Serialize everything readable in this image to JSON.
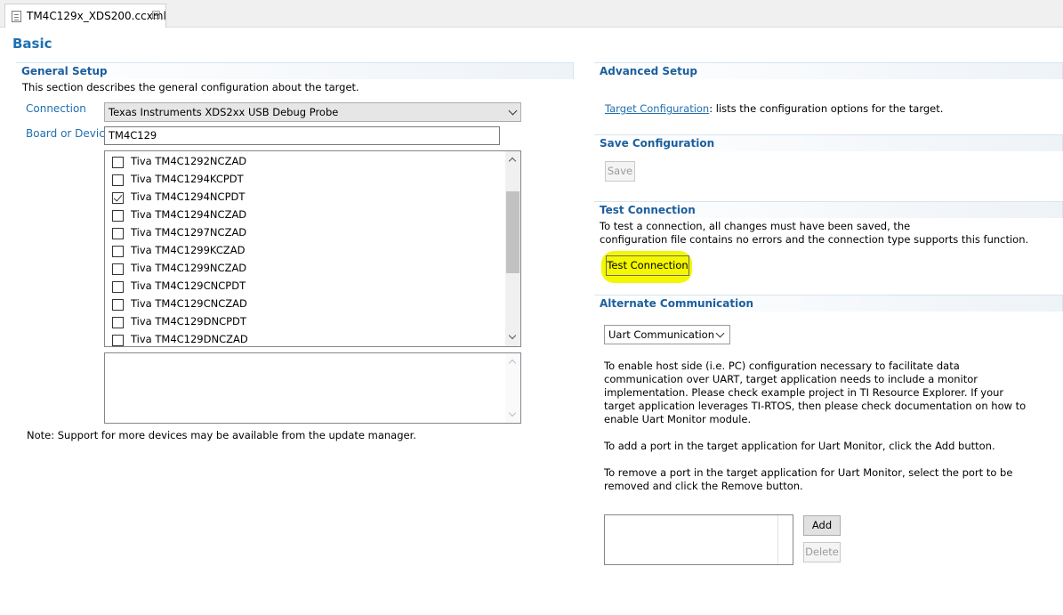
{
  "tab": {
    "title": "TM4C129x_XDS200.ccxml",
    "close_glyph": "☒"
  },
  "page": {
    "title": "Basic"
  },
  "general_setup": {
    "header": "General Setup",
    "description": "This section describes the general configuration about the target.",
    "connection_label": "Connection",
    "connection_value": "Texas Instruments XDS2xx USB Debug Probe",
    "board_label": "Board or Device",
    "board_value": "TM4C129",
    "devices": [
      {
        "label": "Tiva TM4C1292NCZAD",
        "checked": false
      },
      {
        "label": "Tiva TM4C1294KCPDT",
        "checked": false
      },
      {
        "label": "Tiva TM4C1294NCPDT",
        "checked": true
      },
      {
        "label": "Tiva TM4C1294NCZAD",
        "checked": false
      },
      {
        "label": "Tiva TM4C1297NCZAD",
        "checked": false
      },
      {
        "label": "Tiva TM4C1299KCZAD",
        "checked": false
      },
      {
        "label": "Tiva TM4C1299NCZAD",
        "checked": false
      },
      {
        "label": "Tiva TM4C129CNCPDT",
        "checked": false
      },
      {
        "label": "Tiva TM4C129CNCZAD",
        "checked": false
      },
      {
        "label": "Tiva TM4C129DNCPDT",
        "checked": false
      },
      {
        "label": "Tiva TM4C129DNCZAD",
        "checked": false
      }
    ],
    "note": "Note: Support for more devices may be available from the update manager."
  },
  "advanced_setup": {
    "header": "Advanced Setup",
    "link_text": "Target Configuration",
    "link_suffix": ": lists the configuration options for the target."
  },
  "save_configuration": {
    "header": "Save Configuration",
    "save_button": "Save"
  },
  "test_connection": {
    "header": "Test Connection",
    "line1": "To test a connection, all changes must have been saved, the",
    "line2": "configuration file contains no errors and the connection type supports this function.",
    "button": "Test Connection",
    "highlight_color": "#f4f700"
  },
  "alternate_communication": {
    "header": "Alternate Communication",
    "select_value": "Uart Communication",
    "para1": [
      "To enable host side (i.e. PC) configuration necessary to facilitate data",
      "communication over UART, target application needs to include a monitor",
      "implementation. Please check example project in TI Resource Explorer. If your",
      "target application leverages TI-RTOS, then please check documentation on how to",
      "enable Uart Monitor module."
    ],
    "para2": "To add a port in the target application for Uart Monitor, click the Add button.",
    "para3": [
      "To remove a port in the target application for Uart Monitor, select the port to be",
      "removed and click the Remove button."
    ],
    "add_button": "Add",
    "delete_button": "Delete"
  },
  "colors": {
    "header_text": "#1c5f9e",
    "label_text": "#1f6fb0",
    "link": "#1f6fb0"
  }
}
